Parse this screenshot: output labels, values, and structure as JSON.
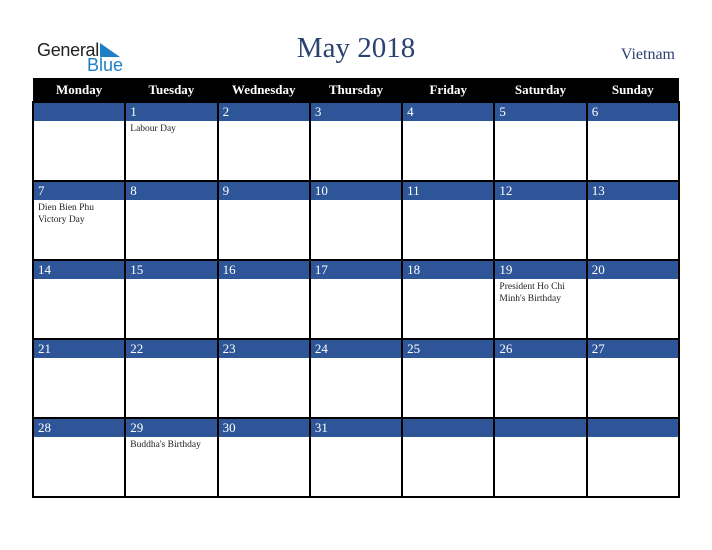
{
  "logo": {
    "line1": "General",
    "line2": "Blue"
  },
  "title": "May 2018",
  "country": "Vietnam",
  "colors": {
    "header_bg": "#000000",
    "band": "#2e5597",
    "title": "#2b4270",
    "logo_blue": "#1f7fc4"
  },
  "weekdays": [
    "Monday",
    "Tuesday",
    "Wednesday",
    "Thursday",
    "Friday",
    "Saturday",
    "Sunday"
  ],
  "weeks": [
    [
      {
        "day": "",
        "holiday": ""
      },
      {
        "day": "1",
        "holiday": "Labour Day"
      },
      {
        "day": "2",
        "holiday": ""
      },
      {
        "day": "3",
        "holiday": ""
      },
      {
        "day": "4",
        "holiday": ""
      },
      {
        "day": "5",
        "holiday": ""
      },
      {
        "day": "6",
        "holiday": ""
      }
    ],
    [
      {
        "day": "7",
        "holiday": "Dien Bien Phu Victory Day"
      },
      {
        "day": "8",
        "holiday": ""
      },
      {
        "day": "9",
        "holiday": ""
      },
      {
        "day": "10",
        "holiday": ""
      },
      {
        "day": "11",
        "holiday": ""
      },
      {
        "day": "12",
        "holiday": ""
      },
      {
        "day": "13",
        "holiday": ""
      }
    ],
    [
      {
        "day": "14",
        "holiday": ""
      },
      {
        "day": "15",
        "holiday": ""
      },
      {
        "day": "16",
        "holiday": ""
      },
      {
        "day": "17",
        "holiday": ""
      },
      {
        "day": "18",
        "holiday": ""
      },
      {
        "day": "19",
        "holiday": "President Ho Chi Minh's Birthday"
      },
      {
        "day": "20",
        "holiday": ""
      }
    ],
    [
      {
        "day": "21",
        "holiday": ""
      },
      {
        "day": "22",
        "holiday": ""
      },
      {
        "day": "23",
        "holiday": ""
      },
      {
        "day": "24",
        "holiday": ""
      },
      {
        "day": "25",
        "holiday": ""
      },
      {
        "day": "26",
        "holiday": ""
      },
      {
        "day": "27",
        "holiday": ""
      }
    ],
    [
      {
        "day": "28",
        "holiday": ""
      },
      {
        "day": "29",
        "holiday": "Buddha's Birthday"
      },
      {
        "day": "30",
        "holiday": ""
      },
      {
        "day": "31",
        "holiday": ""
      },
      {
        "day": "",
        "holiday": ""
      },
      {
        "day": "",
        "holiday": ""
      },
      {
        "day": "",
        "holiday": ""
      }
    ]
  ]
}
